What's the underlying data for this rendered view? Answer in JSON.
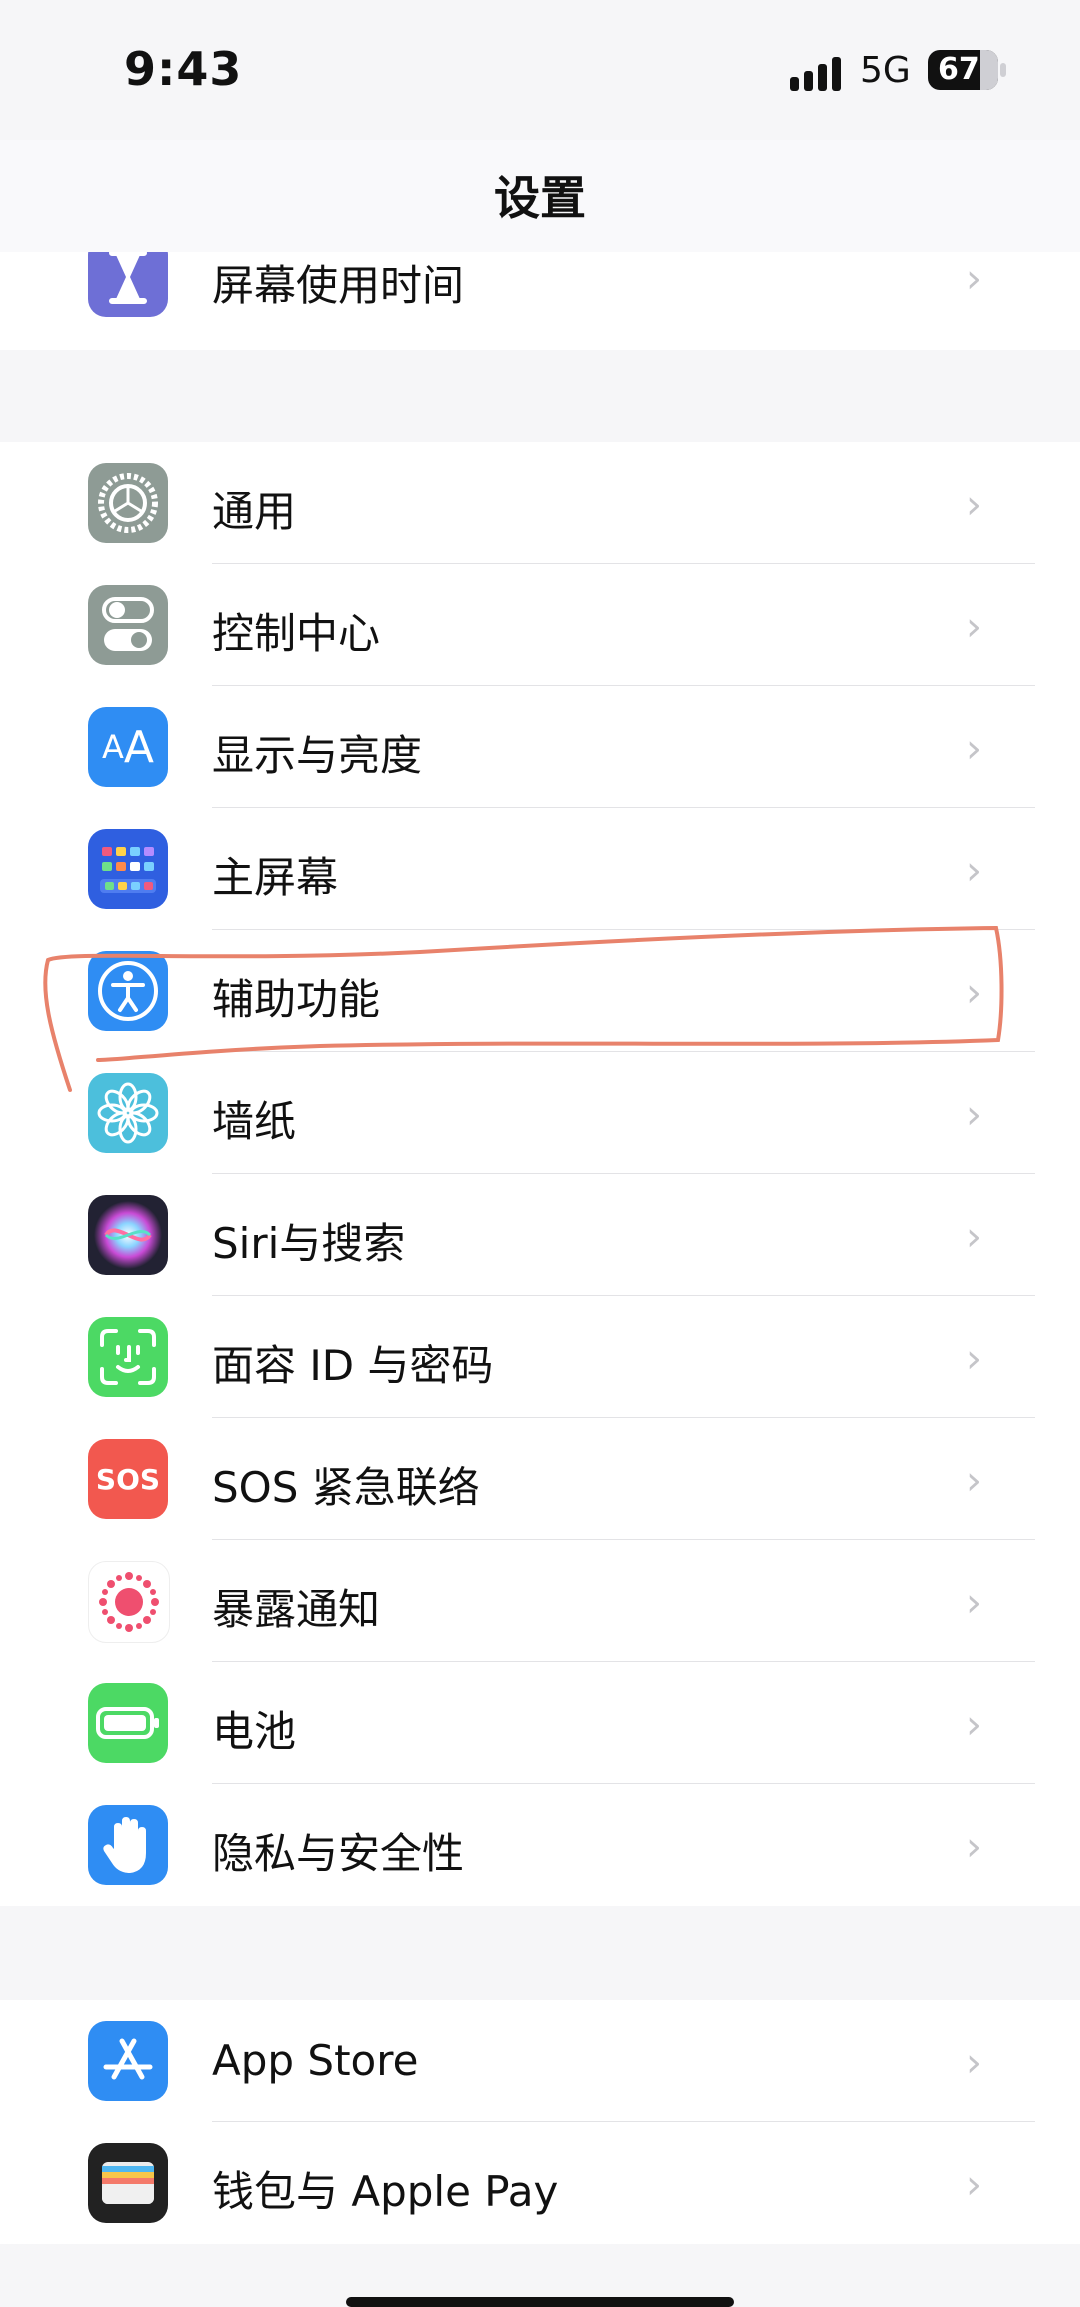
{
  "status_bar": {
    "time": "9:43",
    "network": "5G",
    "battery": "67"
  },
  "nav": {
    "title": "设置"
  },
  "group_top": [
    {
      "label": "屏幕使用时间",
      "icon": "hourglass-icon",
      "color": "#6e6fd6"
    }
  ],
  "group_main": [
    {
      "label": "通用",
      "icon": "gear-icon",
      "color": "#8e9b95"
    },
    {
      "label": "控制中心",
      "icon": "toggles-icon",
      "color": "#8e9b95"
    },
    {
      "label": "显示与亮度",
      "icon": "text-size-icon",
      "color": "#2f8df3"
    },
    {
      "label": "主屏幕",
      "icon": "home-grid-icon",
      "color": "#2f5fe0"
    },
    {
      "label": "辅助功能",
      "icon": "accessibility-icon",
      "color": "#2f8df3"
    },
    {
      "label": "墙纸",
      "icon": "flower-icon",
      "color": "#4cbfdc"
    },
    {
      "label": "Siri与搜索",
      "icon": "siri-icon",
      "color": "#222233"
    },
    {
      "label": "面容 ID 与密码",
      "icon": "face-id-icon",
      "color": "#4cd964"
    },
    {
      "label": "SOS 紧急联络",
      "icon": "sos-icon",
      "icon_text": "SOS",
      "color": "#f2584f"
    },
    {
      "label": "暴露通知",
      "icon": "exposure-icon",
      "color": "#ffffff"
    },
    {
      "label": "电池",
      "icon": "battery-icon",
      "color": "#4cd964"
    },
    {
      "label": "隐私与安全性",
      "icon": "hand-icon",
      "color": "#2f8df3"
    }
  ],
  "group_store": [
    {
      "label": "App Store",
      "icon": "app-store-icon",
      "color": "#2f8df3"
    },
    {
      "label": "钱包与 Apple Pay",
      "icon": "wallet-icon",
      "color": "#222222"
    }
  ],
  "annotation_color": "#e8826b"
}
